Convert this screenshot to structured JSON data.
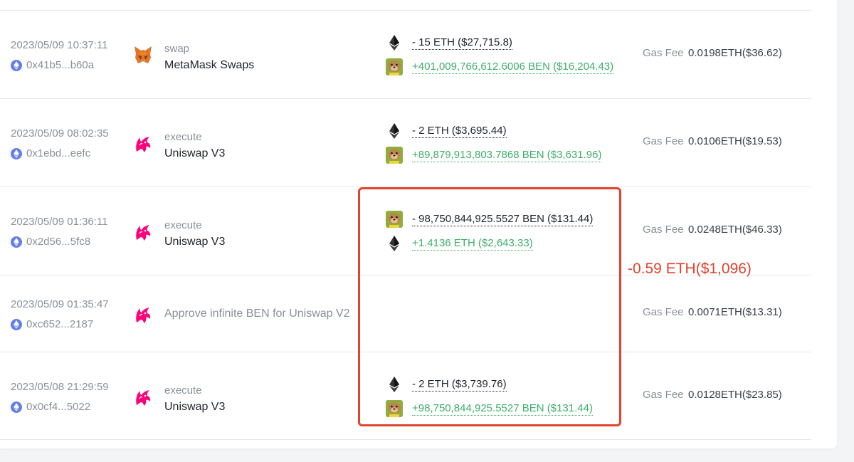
{
  "colors": {
    "negative": "#1f2329",
    "positive": "#3dae6a",
    "highlight": "#e2432c",
    "muted": "#8a9099"
  },
  "gas_label": "Gas Fee",
  "annotation": "-0.59 ETH($1,096)",
  "transactions": [
    {
      "time": "2023/05/09 10:37:11",
      "hash": "0x41b5...b60a",
      "app_icon": "metamask-fox-icon",
      "method": "swap",
      "app_name": "MetaMask Swaps",
      "tokens": [
        {
          "icon": "eth-icon",
          "amount": "- 15 ETH ($27,715.8)"
        },
        {
          "icon": "ben-icon",
          "amount": "+401,009,766,612.6006 BEN ($16,204.43)"
        }
      ],
      "gas_fee": "0.0198ETH($36.62)"
    },
    {
      "time": "2023/05/09 08:02:35",
      "hash": "0x1ebd...eefc",
      "app_icon": "uniswap-unicorn-icon",
      "method": "execute",
      "app_name": "Uniswap V3",
      "tokens": [
        {
          "icon": "eth-icon",
          "amount": "- 2 ETH ($3,695.44)"
        },
        {
          "icon": "ben-icon",
          "amount": "+89,879,913,803.7868 BEN ($3,631.96)"
        }
      ],
      "gas_fee": "0.0106ETH($19.53)"
    },
    {
      "time": "2023/05/09 01:36:11",
      "hash": "0x2d56...5fc8",
      "app_icon": "uniswap-unicorn-icon",
      "method": "execute",
      "app_name": "Uniswap V3",
      "tokens": [
        {
          "icon": "ben-icon",
          "amount": "- 98,750,844,925.5527 BEN ($131.44)"
        },
        {
          "icon": "eth-icon",
          "amount": "+1.4136 ETH ($2,643.33)"
        }
      ],
      "gas_fee": "0.0248ETH($46.33)"
    },
    {
      "time": "2023/05/09 01:35:47",
      "hash": "0xc652...2187",
      "app_icon": "uniswap-unicorn-icon",
      "approve_text": "Approve infinite BEN for Uniswap V2",
      "gas_fee": "0.0071ETH($13.31)"
    },
    {
      "time": "2023/05/08 21:29:59",
      "hash": "0x0cf4...5022",
      "app_icon": "uniswap-unicorn-icon",
      "method": "execute",
      "app_name": "Uniswap V3",
      "tokens": [
        {
          "icon": "eth-icon",
          "amount": "- 2 ETH ($3,739.76)"
        },
        {
          "icon": "ben-icon",
          "amount": "+98,750,844,925.5527 BEN ($131.44)"
        }
      ],
      "gas_fee": "0.0128ETH($23.85)"
    }
  ]
}
